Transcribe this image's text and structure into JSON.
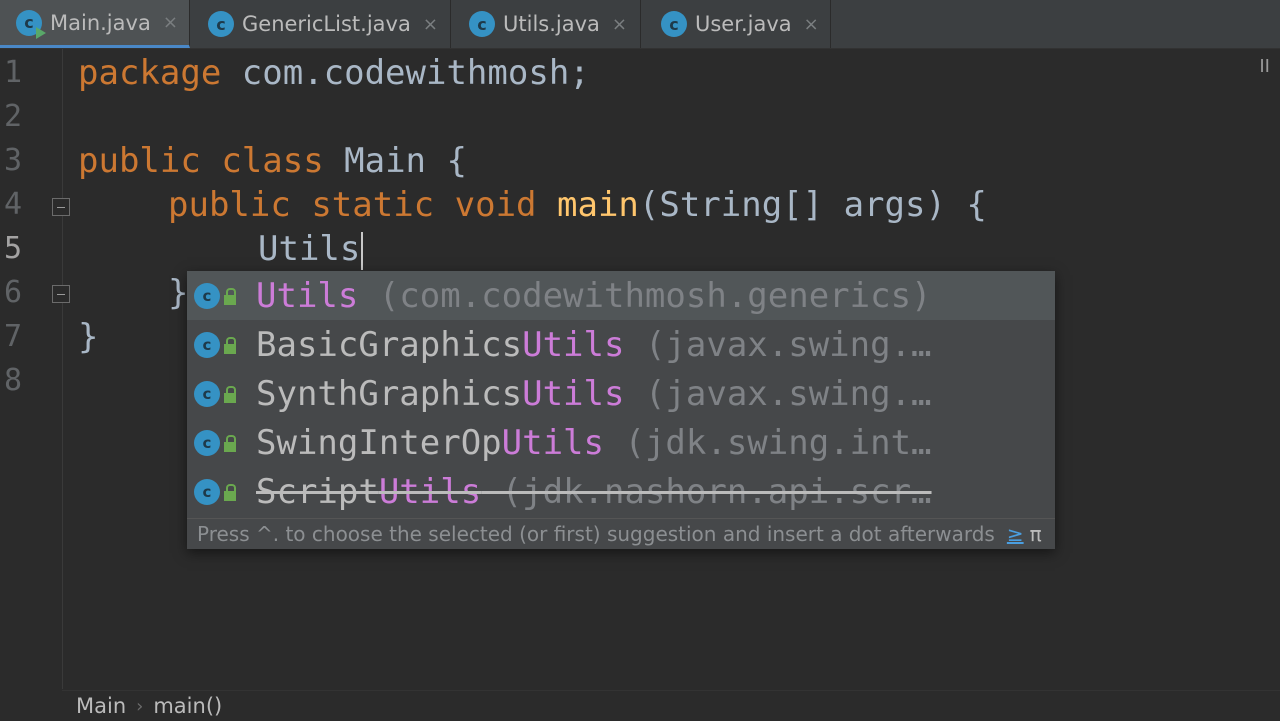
{
  "tabs": [
    {
      "label": "Main.java",
      "icon": "c-class-icon",
      "active": true
    },
    {
      "label": "GenericList.java",
      "icon": "c-class-icon",
      "active": false
    },
    {
      "label": "Utils.java",
      "icon": "c-class-icon",
      "active": false
    },
    {
      "label": "User.java",
      "icon": "c-class-icon",
      "active": false
    }
  ],
  "tab_close_glyph": "×",
  "icon_letter": "c",
  "line_numbers": [
    "1",
    "2",
    "3",
    "4",
    "5",
    "6",
    "7",
    "8"
  ],
  "code": {
    "l1_kw": "package",
    "l1_rest": " com.codewithmosh;",
    "l3_kw1": "public",
    "l3_kw2": "class",
    "l3_rest": " Main {",
    "l4_kw1": "public",
    "l4_kw2": "static",
    "l4_kw3": "void",
    "l4_fn": "main",
    "l4_rest": "(String[] args) {",
    "l5_text": "Utils",
    "l6_text": "}",
    "l7_text": "}"
  },
  "completion": {
    "items": [
      {
        "prefix": "",
        "match": "Utils",
        "pkg": " (com.codewithmosh.generics)"
      },
      {
        "prefix": "BasicGraphics",
        "match": "Utils",
        "pkg": " (javax.swing.…"
      },
      {
        "prefix": "SynthGraphics",
        "match": "Utils",
        "pkg": " (javax.swing.…"
      },
      {
        "prefix": "SwingInterOp",
        "match": "Utils",
        "pkg": " (jdk.swing.int…"
      },
      {
        "prefix": "Script",
        "match": "Utils",
        "pkg": " (jdk.nashorn.api.scr…"
      }
    ],
    "hint_text": "Press ^. to choose the selected (or first) suggestion and insert a dot afterwards",
    "hint_link": "≥",
    "hint_pi": "π"
  },
  "breadcrumbs": {
    "items": [
      "Main",
      "main()"
    ],
    "separator": "›"
  },
  "right_marker": "II",
  "colors": {
    "keyword": "#cc7832",
    "function": "#ffc66d",
    "match": "#cc7cd8",
    "background": "#2b2b2b",
    "accent": "#4a88c7"
  }
}
